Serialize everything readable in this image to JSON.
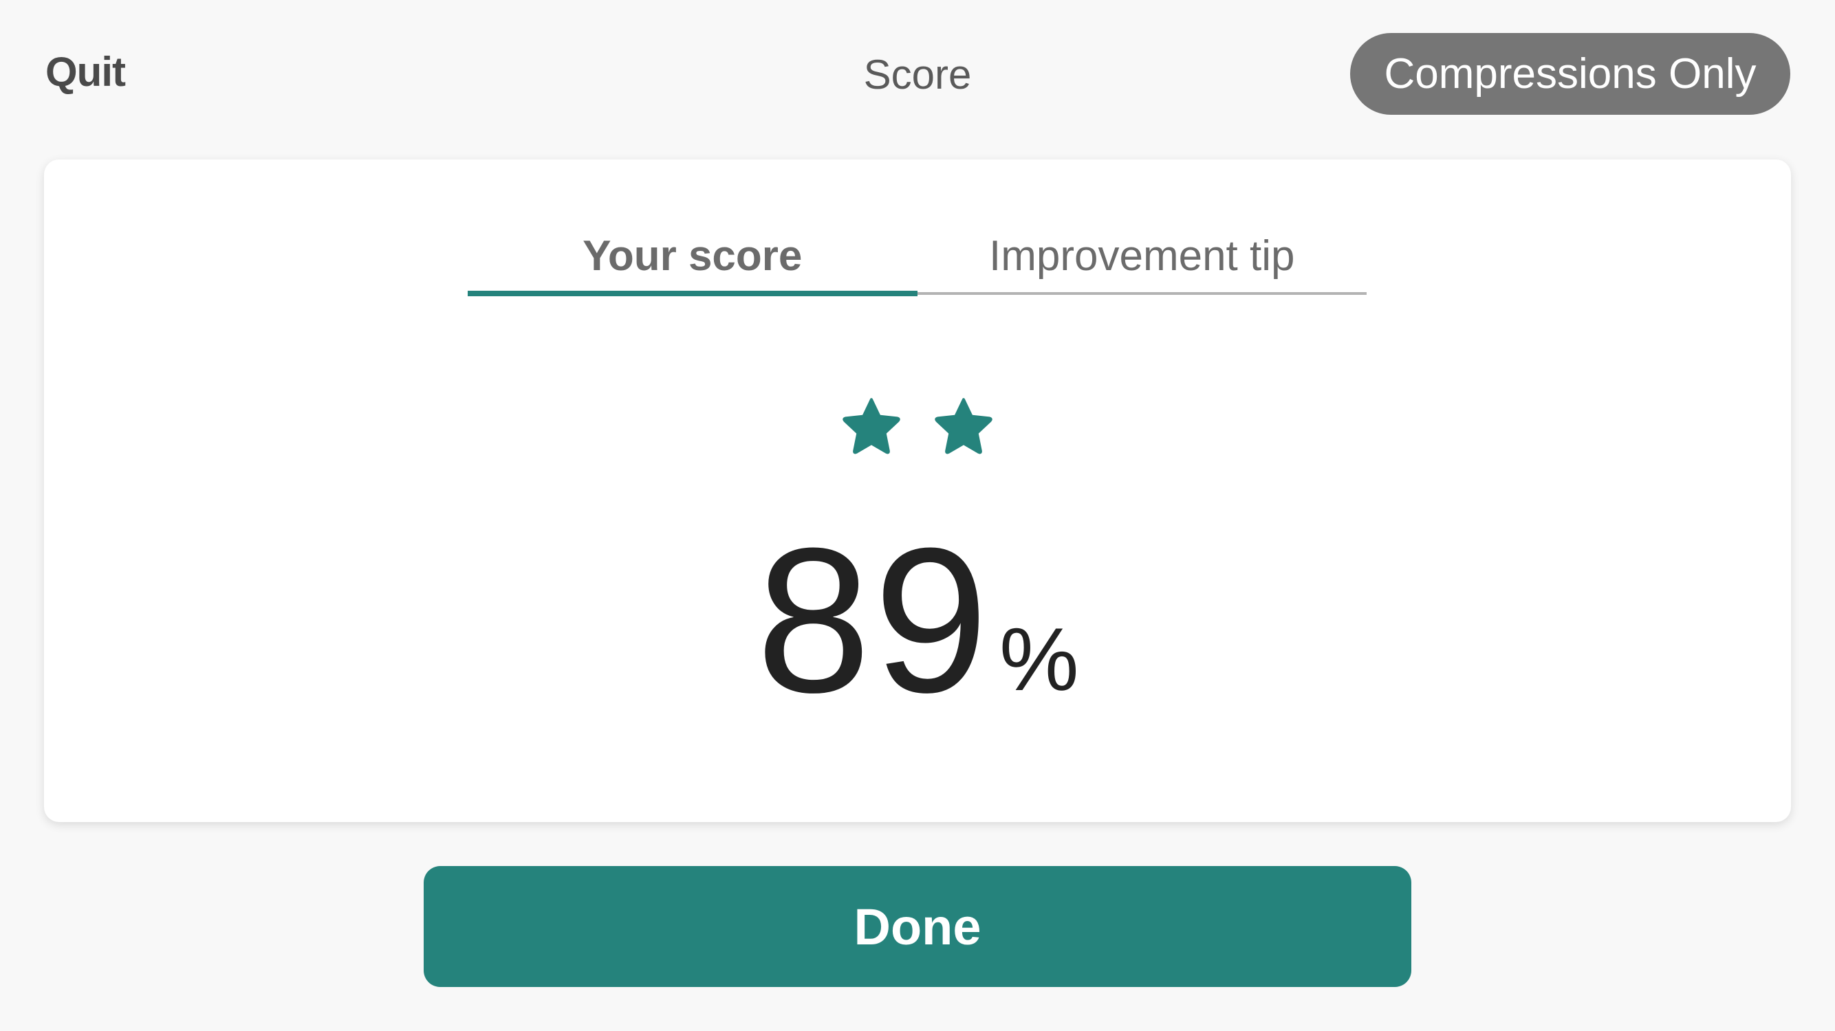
{
  "header": {
    "quit_label": "Quit",
    "title": "Score",
    "mode_badge": "Compressions Only"
  },
  "tabs": [
    {
      "label": "Your score",
      "active": true
    },
    {
      "label": "Improvement tip",
      "active": false
    }
  ],
  "score": {
    "stars_filled": 2,
    "star_icon": "star-icon",
    "value": "89",
    "unit": "%"
  },
  "footer": {
    "done_label": "Done"
  },
  "colors": {
    "accent": "#25837c",
    "badge_bg": "#767676",
    "background": "#f8f8f8"
  }
}
